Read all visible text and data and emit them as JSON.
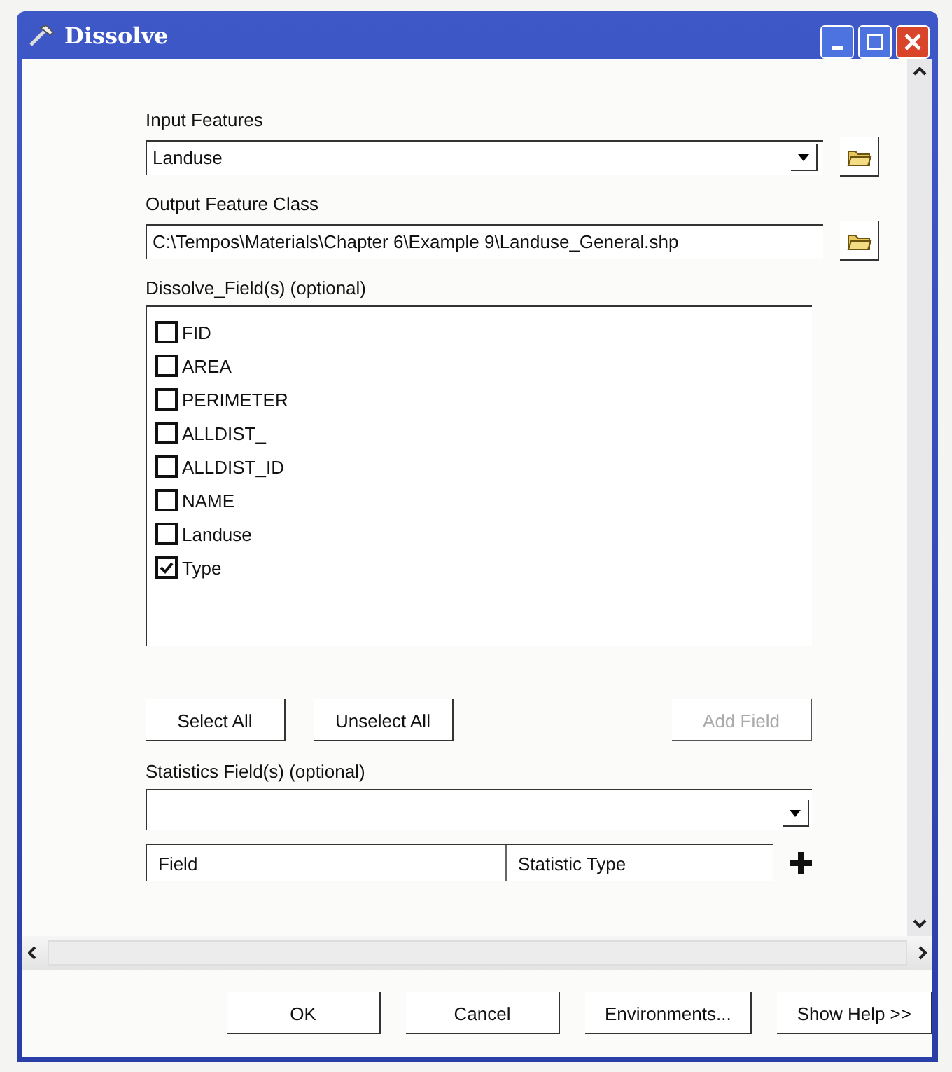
{
  "window": {
    "title": "Dissolve"
  },
  "input_features": {
    "label": "Input Features",
    "value": "Landuse"
  },
  "output_feature_class": {
    "label": "Output Feature Class",
    "value": "C:\\Tempos\\Materials\\Chapter 6\\Example 9\\Landuse_General.shp"
  },
  "dissolve_fields": {
    "label": "Dissolve_Field(s) (optional)",
    "items": [
      {
        "name": "FID",
        "checked": false
      },
      {
        "name": "AREA",
        "checked": false
      },
      {
        "name": "PERIMETER",
        "checked": false
      },
      {
        "name": "ALLDIST_",
        "checked": false
      },
      {
        "name": "ALLDIST_ID",
        "checked": false
      },
      {
        "name": "NAME",
        "checked": false
      },
      {
        "name": "Landuse",
        "checked": false
      },
      {
        "name": "Type",
        "checked": true
      }
    ]
  },
  "field_buttons": [
    {
      "label": "Select All",
      "disabled": false
    },
    {
      "label": "Unselect All",
      "disabled": false
    },
    {
      "label": "Add Field",
      "disabled": true
    }
  ],
  "statistics_fields": {
    "label": "Statistics Field(s) (optional)",
    "columns": [
      "Field",
      "Statistic Type"
    ]
  },
  "buttons": [
    "OK",
    "Cancel",
    "Environments...",
    "Show Help >>"
  ]
}
